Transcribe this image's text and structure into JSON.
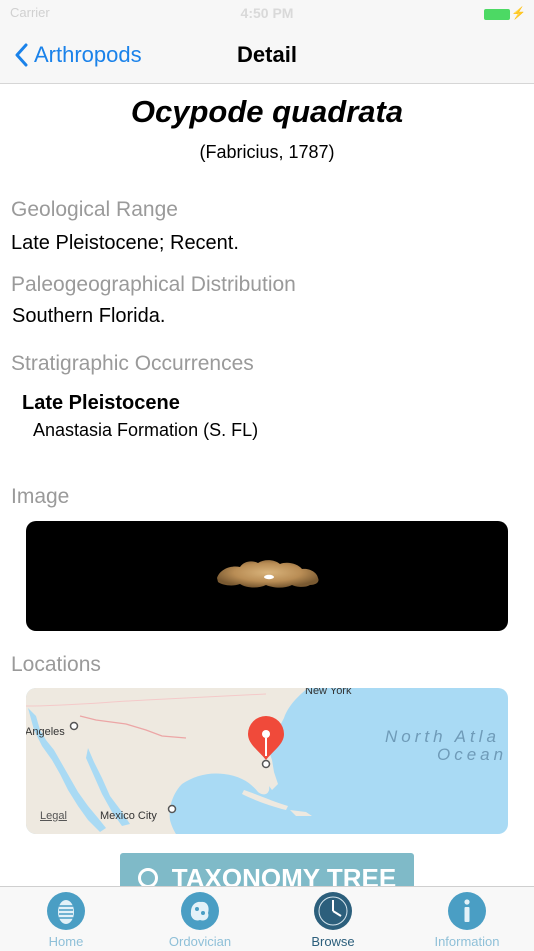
{
  "status_bar": {
    "carrier": "Carrier",
    "time": "4:50 PM"
  },
  "nav": {
    "back_label": "Arthropods",
    "title": "Detail"
  },
  "species": {
    "name": "Ocypode quadrata",
    "authority": "(Fabricius, 1787)"
  },
  "geological_range": {
    "label": "Geological Range",
    "value": "Late Pleistocene; Recent."
  },
  "distribution": {
    "label": "Paleogeographical Distribution",
    "value": "Southern Florida."
  },
  "stratigraphic": {
    "label": "Stratigraphic Occurrences",
    "occurrences": [
      {
        "age": "Late Pleistocene",
        "formation": "Anastasia Formation (S. FL)"
      }
    ]
  },
  "image_section": {
    "label": "Image"
  },
  "locations": {
    "label": "Locations",
    "map": {
      "new_york": "New York",
      "angeles": "Angeles",
      "ocean_line1": "North Atla",
      "ocean_line2": "Ocean",
      "mexico_city": "Mexico City",
      "legal": "Legal"
    }
  },
  "taxonomy_button": "TAXONOMY TREE",
  "tabs": [
    {
      "label": "Home",
      "icon": "trilobite-icon",
      "active": false
    },
    {
      "label": "Ordovician",
      "icon": "coral-icon",
      "active": false
    },
    {
      "label": "Browse",
      "icon": "clock-icon",
      "active": true
    },
    {
      "label": "Information",
      "icon": "info-icon",
      "active": false
    }
  ],
  "colors": {
    "accent": "#1a82ea",
    "tab_icon": "#4a9ec4",
    "tab_active": "#2c5f7c",
    "tab_inactive_label": "#8fc0d8"
  }
}
